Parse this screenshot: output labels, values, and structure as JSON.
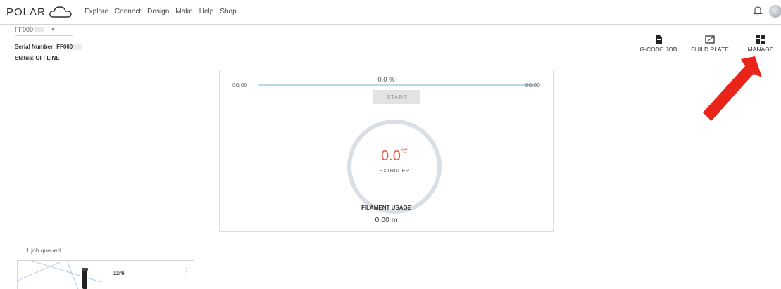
{
  "brand": {
    "name": "POLAR",
    "logo_icon": "cloud-icon"
  },
  "nav": [
    "Explore",
    "Connect",
    "Design",
    "Make",
    "Help",
    "Shop"
  ],
  "header_icons": {
    "notifications": "bell-icon",
    "profile": "avatar"
  },
  "printer": {
    "selected": "FF000",
    "serial_label": "Serial Number: FF000",
    "status_label": "Status: OFFLINE"
  },
  "actions": [
    {
      "label": "G-CODE JOB",
      "icon": "file-icon"
    },
    {
      "label": "BUILD PLATE",
      "icon": "build-plate-icon"
    },
    {
      "label": "MANAGE",
      "icon": "grid-icon"
    }
  ],
  "print": {
    "percent": "0.0 %",
    "progress": 0.0,
    "elapsed": "00:00",
    "remaining": "00:00",
    "start_label": "START"
  },
  "extruder": {
    "temperature": "0.0",
    "unit": "℃",
    "label": "EXTRUDER"
  },
  "filament": {
    "label": "FILAMENT USAGE",
    "value": "0.00 m"
  },
  "queue": {
    "summary": "1 job queued",
    "jobs": [
      {
        "name": "zzr6",
        "menu_icon": "more-vertical-icon"
      }
    ]
  },
  "colors": {
    "accent_red": "#e05a4c",
    "progress_blue": "#bcd9ec",
    "arrow_red": "#e8241b",
    "thumb_teal": "#1fb2a7"
  }
}
